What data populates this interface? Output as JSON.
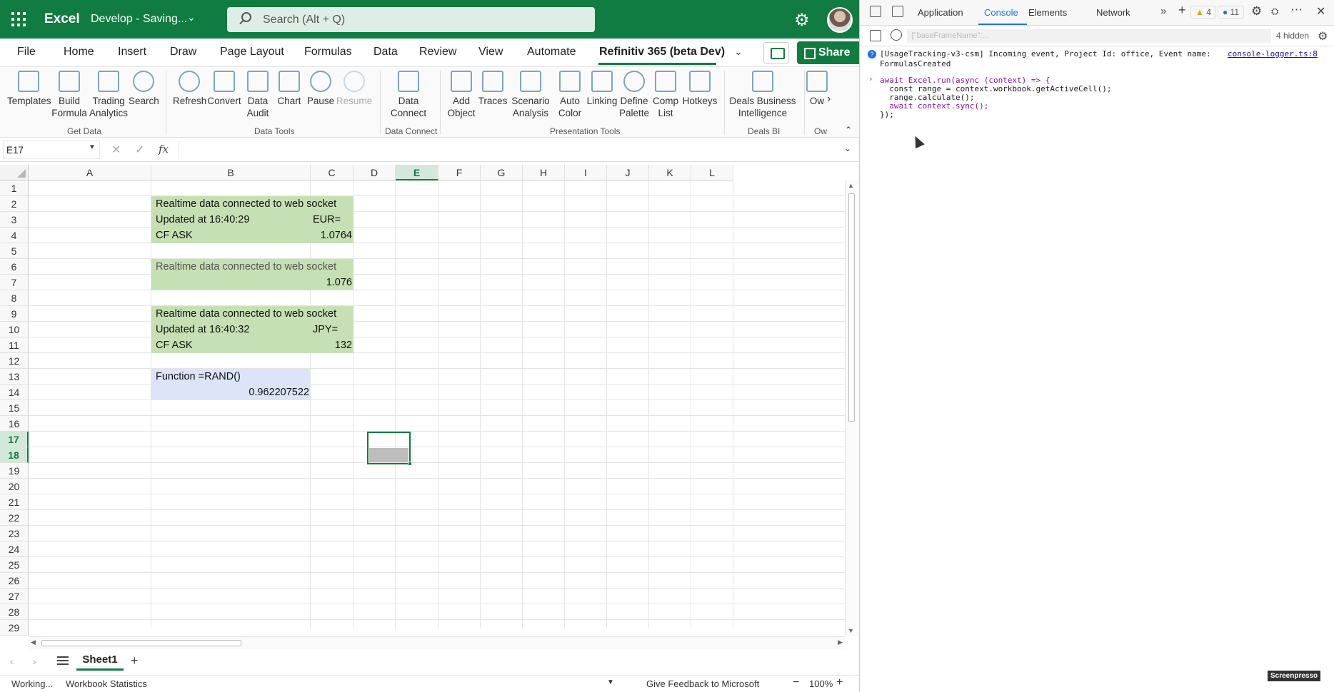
{
  "app": {
    "name": "Excel",
    "doc_title": "Develop - Saving...",
    "search_placeholder": "Search (Alt + Q)"
  },
  "menu": {
    "tabs": [
      "File",
      "Home",
      "Insert",
      "Draw",
      "Page Layout",
      "Formulas",
      "Data",
      "Review",
      "View",
      "Automate",
      "Refinitiv 365 (beta Dev)"
    ],
    "active_tab": "Refinitiv 365 (beta Dev)",
    "share_label": "Share"
  },
  "ribbon": {
    "buttons": [
      {
        "label": "Templates",
        "icon": "templates-icon"
      },
      {
        "label": "Build Formula",
        "icon": "function-icon"
      },
      {
        "label": "Trading Analytics",
        "icon": "chart-line-icon"
      },
      {
        "label": "Search",
        "icon": "search-icon"
      },
      {
        "label": "Refresh",
        "icon": "refresh-icon"
      },
      {
        "label": "Convert",
        "icon": "convert-icon"
      },
      {
        "label": "Data Audit",
        "icon": "data-audit-icon"
      },
      {
        "label": "Chart",
        "icon": "bar-chart-icon"
      },
      {
        "label": "Pause",
        "icon": "pause-icon"
      },
      {
        "label": "Resume",
        "icon": "resume-icon",
        "disabled": true
      },
      {
        "label": "Data Connect",
        "icon": "data-connect-icon"
      },
      {
        "label": "Add Object",
        "icon": "add-object-icon"
      },
      {
        "label": "Traces",
        "icon": "traces-icon"
      },
      {
        "label": "Scenario Analysis",
        "icon": "scenario-icon"
      },
      {
        "label": "Auto Color",
        "icon": "auto-color-icon"
      },
      {
        "label": "Linking",
        "icon": "linking-icon"
      },
      {
        "label": "Define Palette",
        "icon": "palette-icon"
      },
      {
        "label": "Comp List",
        "icon": "comp-list-icon"
      },
      {
        "label": "Hotkeys",
        "icon": "hotkeys-icon"
      },
      {
        "label": "Deals Business Intelligence",
        "icon": "deals-bi-icon"
      },
      {
        "label": "Ow",
        "icon": "ownership-icon"
      }
    ],
    "groups": [
      "Get Data",
      "Data Tools",
      "Data Connect",
      "Presentation Tools",
      "Deals BI",
      "Ow"
    ]
  },
  "formula_bar": {
    "name_box": "E17",
    "formula": ""
  },
  "grid": {
    "columns": [
      "A",
      "B",
      "C",
      "D",
      "E",
      "F",
      "G",
      "H",
      "I",
      "J",
      "K",
      "L"
    ],
    "selected_column": "E",
    "rows": [
      "1",
      "2",
      "3",
      "4",
      "5",
      "6",
      "7",
      "8",
      "9",
      "10",
      "11",
      "12",
      "13",
      "14",
      "15",
      "16",
      "17",
      "18",
      "19",
      "20",
      "21",
      "22",
      "23",
      "24",
      "25",
      "26",
      "27",
      "28",
      "29"
    ],
    "selected_rows": [
      "17",
      "18"
    ],
    "cells": {
      "b2": "Realtime data connected to web socket",
      "b3": "Updated at 16:40:29",
      "c3": "EUR=",
      "b4": "CF ASK",
      "c4": "1.0764",
      "b6": "Realtime data connected to web socket",
      "c7": "1.076",
      "b9": "Realtime data connected to web socket",
      "b10": "Updated at 16:40:32",
      "c10": "JPY=",
      "b11": "CF ASK",
      "c11": "132",
      "b13": "Function =RAND()",
      "b14": "0.962207522"
    },
    "colors": {
      "green_fill": "#c6e0b4",
      "blue_fill": "#dbe5f7",
      "accent": "#107c41"
    }
  },
  "sheets": {
    "tabs": [
      "Sheet1"
    ]
  },
  "status": {
    "left": "Working...",
    "stats": "Workbook Statistics",
    "feedback": "Give Feedback to Microsoft",
    "zoom": "100%"
  },
  "devtools": {
    "tabs": [
      "Application",
      "Console",
      "Elements",
      "Network"
    ],
    "active_tab": "Console",
    "warn_count": "4",
    "info_count": "11",
    "filter_placeholder": "{\"baseFrameName\":...",
    "hidden_label": "4 hidden",
    "log": {
      "line1": "[UsageTracking-v3-csm] Incoming event, Project Id: office, Event name:",
      "line2": "FormulasCreated",
      "source": "console-logger.ts:8"
    },
    "code": [
      "await Excel.run(async (context) => {",
      "  const range = context.workbook.getActiveCell();",
      "  range.calculate();",
      "  await context.sync();",
      "});"
    ]
  },
  "watermark": "Screenpresso"
}
